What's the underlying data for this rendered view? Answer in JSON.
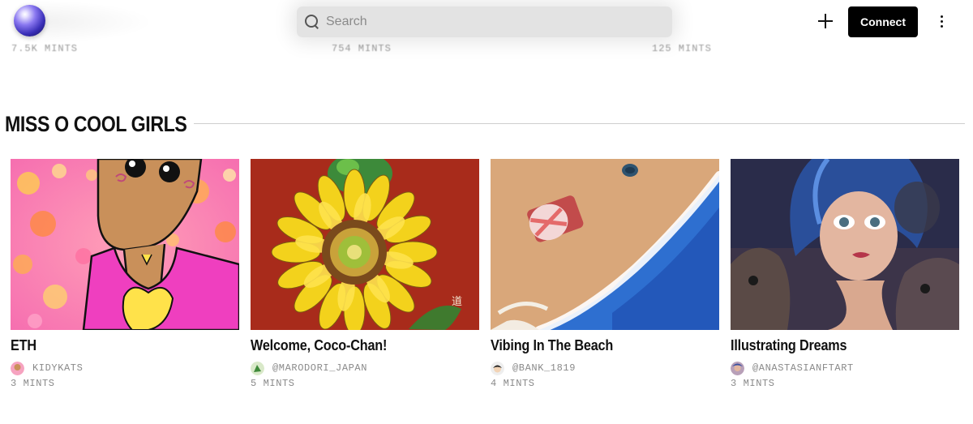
{
  "header": {
    "search_placeholder": "Search",
    "connect_label": "Connect",
    "ghost_stats": [
      "7.5K MINTS",
      "754 MINTS",
      "125 MINTS"
    ]
  },
  "section": {
    "title": "MISS O COOL GIRLS"
  },
  "cards": [
    {
      "title": "ETH",
      "creator": "KIDYKATS",
      "mints": "3 MINTS"
    },
    {
      "title": "Welcome, Coco-Chan!",
      "creator": "@MARODORI_JAPAN",
      "mints": "5 MINTS"
    },
    {
      "title": "Vibing In The Beach",
      "creator": "@BANK_1819",
      "mints": "4 MINTS"
    },
    {
      "title": "Illustrating Dreams",
      "creator": "@ANASTASIANFTART",
      "mints": "3 MINTS"
    }
  ],
  "colors": {
    "connect_bg": "#000000",
    "search_bg": "#e3e3e3",
    "muted_text": "#8a8a8a"
  }
}
